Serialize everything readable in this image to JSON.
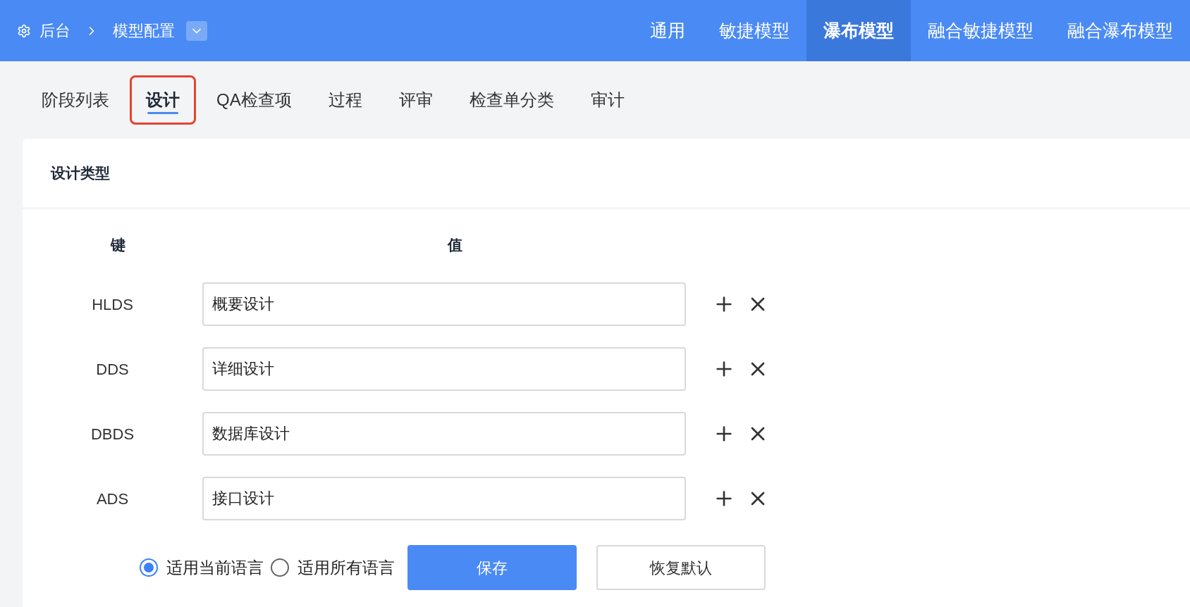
{
  "breadcrumb": {
    "root": "后台",
    "current": "模型配置"
  },
  "top_tabs": [
    {
      "label": "通用",
      "selected": false
    },
    {
      "label": "敏捷模型",
      "selected": false
    },
    {
      "label": "瀑布模型",
      "selected": true
    },
    {
      "label": "融合敏捷模型",
      "selected": false
    },
    {
      "label": "融合瀑布模型",
      "selected": false
    }
  ],
  "sub_tabs": [
    {
      "label": "阶段列表",
      "selected": false,
      "highlighted": false
    },
    {
      "label": "设计",
      "selected": true,
      "highlighted": true
    },
    {
      "label": "QA检查项",
      "selected": false,
      "highlighted": false
    },
    {
      "label": "过程",
      "selected": false,
      "highlighted": false
    },
    {
      "label": "评审",
      "selected": false,
      "highlighted": false
    },
    {
      "label": "检查单分类",
      "selected": false,
      "highlighted": false
    },
    {
      "label": "审计",
      "selected": false,
      "highlighted": false
    }
  ],
  "card": {
    "title": "设计类型",
    "key_header": "键",
    "value_header": "值",
    "rows": [
      {
        "key": "HLDS",
        "value": "概要设计"
      },
      {
        "key": "DDS",
        "value": "详细设计"
      },
      {
        "key": "DBDS",
        "value": "数据库设计"
      },
      {
        "key": "ADS",
        "value": "接口设计"
      }
    ],
    "scope_options": [
      {
        "label": "适用当前语言",
        "selected": true
      },
      {
        "label": "适用所有语言",
        "selected": false
      }
    ],
    "save_button": "保存",
    "reset_button": "恢复默认"
  }
}
